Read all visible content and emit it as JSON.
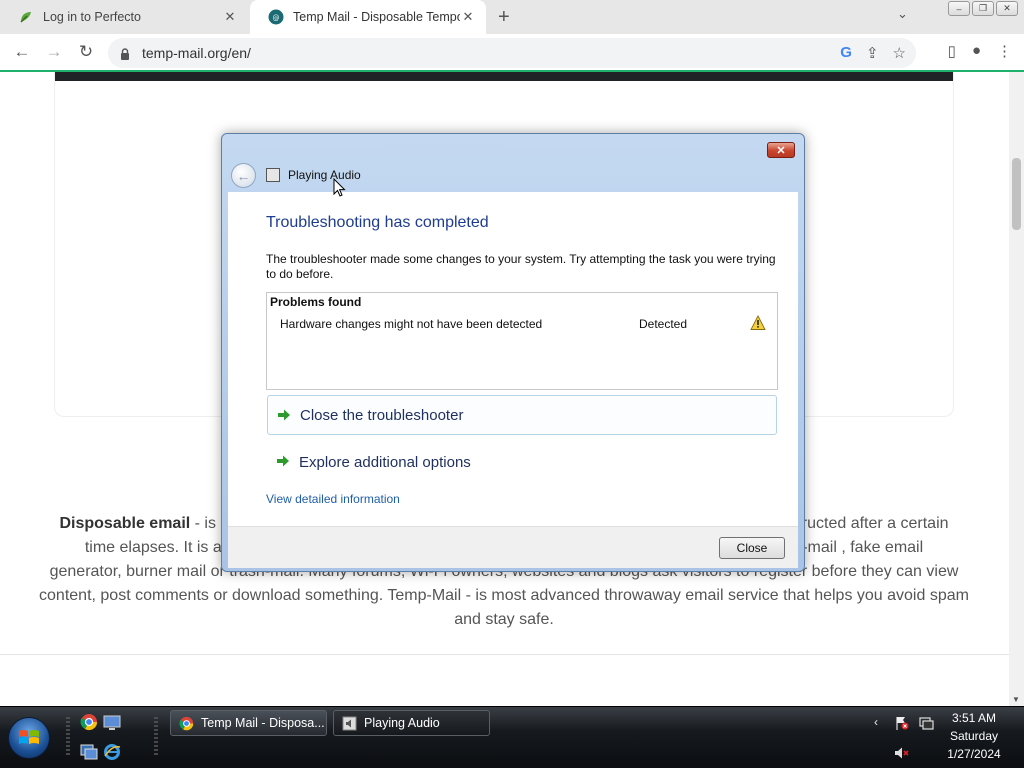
{
  "browser": {
    "tabs": [
      {
        "title": "Log in to Perfecto",
        "active": false
      },
      {
        "title": "Temp Mail - Disposable Tempora",
        "active": true
      }
    ],
    "url": "temp-mail.org/en/"
  },
  "page": {
    "description_bold": "Disposable email",
    "description_lines": [
      " - is a",
      "structed after a certain",
      "time elapses. It is als",
      "e-mail , fake email",
      "generator, burner mail or trash-mail. Many forums, Wi-Fi owners, websites and blogs ask visitors to register before they can view",
      "content, post comments or download something. Temp-Mail - is most advanced throwaway email service that helps you avoid spam",
      "and stay safe."
    ]
  },
  "dialog": {
    "app_title": "Playing Audio",
    "heading": "Troubleshooting has completed",
    "message": "The troubleshooter made some changes to your system. Try attempting the task you were trying to do before.",
    "problems_header": "Problems found",
    "problems": [
      {
        "name": "Hardware changes might not have been detected",
        "status": "Detected",
        "icon": "warning-icon"
      }
    ],
    "commands": [
      "Close the troubleshooter",
      "Explore additional options"
    ],
    "link": "View detailed information",
    "close_button": "Close"
  },
  "taskbar": {
    "buttons": [
      "Temp Mail - Disposa...",
      "Playing Audio"
    ],
    "time": "3:51 AM",
    "day": "Saturday",
    "date": "1/27/2024"
  }
}
